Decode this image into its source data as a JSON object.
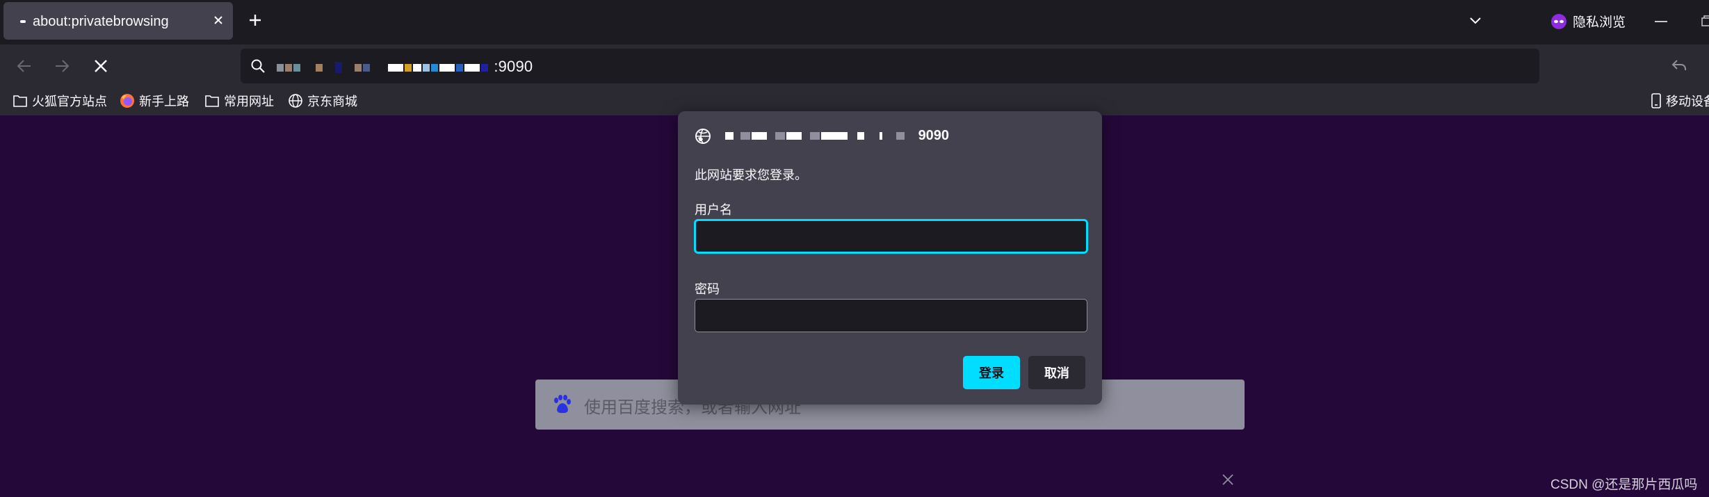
{
  "tab": {
    "title": "about:privatebrowsing"
  },
  "private_indicator": {
    "label": "隐私浏览"
  },
  "urlbar": {
    "visible_suffix": ":9090"
  },
  "bookmarks": [
    {
      "label": "火狐官方站点",
      "icon": "folder-icon"
    },
    {
      "label": "新手上路",
      "icon": "firefox-icon"
    },
    {
      "label": "常用网址",
      "icon": "folder-icon"
    },
    {
      "label": "京东商城",
      "icon": "globe-icon"
    }
  ],
  "mobile_bookmarks": {
    "label": "移动设备"
  },
  "dialog": {
    "host_suffix": "9090",
    "message": "此网站要求您登录。",
    "username_label": "用户名",
    "username_value": "",
    "password_label": "密码",
    "password_value": "",
    "login_button": "登录",
    "cancel_button": "取消"
  },
  "search": {
    "placeholder": "使用百度搜索，或者输入网址"
  },
  "watermark": "CSDN @还是那片西瓜吗",
  "colors": {
    "accent": "#00ddff",
    "page_bg": "#25083a",
    "dialog_bg": "#42414d"
  }
}
